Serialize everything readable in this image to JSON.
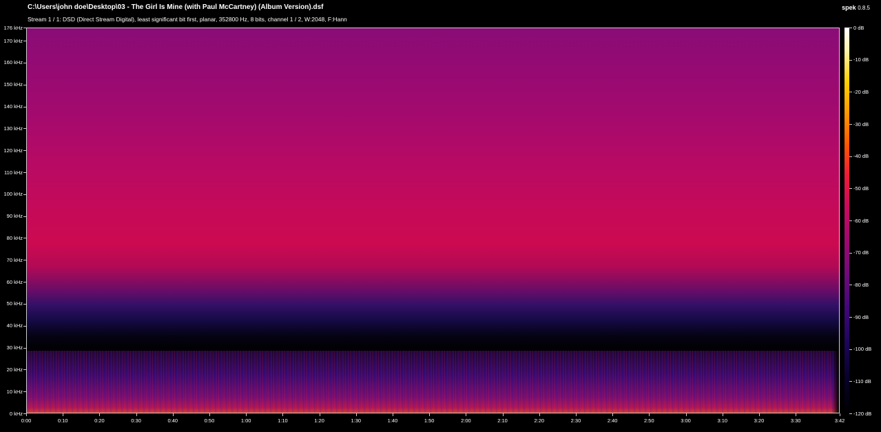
{
  "header": {
    "file_path": "C:\\Users\\john doe\\Desktop\\03 - The Girl Is Mine (with Paul McCartney) (Album Version).dsf",
    "stream_info": "Stream 1 / 1: DSD (Direct Stream Digital), least significant bit first, planar, 352800 Hz, 8 bits, channel 1 / 2, W:2048, F:Hann",
    "app_name": "spek",
    "app_version": "0.8.5"
  },
  "frequency_axis": {
    "labels": [
      "176 kHz",
      "170 kHz",
      "160 kHz",
      "150 kHz",
      "140 kHz",
      "130 kHz",
      "120 kHz",
      "110 kHz",
      "100 kHz",
      "90 kHz",
      "80 kHz",
      "70 kHz",
      "60 kHz",
      "50 kHz",
      "40 kHz",
      "30 kHz",
      "20 kHz",
      "10 kHz",
      "0 kHz"
    ],
    "values_khz": [
      176,
      170,
      160,
      150,
      140,
      130,
      120,
      110,
      100,
      90,
      80,
      70,
      60,
      50,
      40,
      30,
      20,
      10,
      0
    ],
    "max_khz": 176
  },
  "time_axis": {
    "labels": [
      "0:00",
      "0:10",
      "0:20",
      "0:30",
      "0:40",
      "0:50",
      "1:00",
      "1:10",
      "1:20",
      "1:30",
      "1:40",
      "1:50",
      "2:00",
      "2:10",
      "2:20",
      "2:30",
      "2:40",
      "2:50",
      "3:00",
      "3:10",
      "3:20",
      "3:30",
      "3:42"
    ],
    "values_sec": [
      0,
      10,
      20,
      30,
      40,
      50,
      60,
      70,
      80,
      90,
      100,
      110,
      120,
      130,
      140,
      150,
      160,
      170,
      180,
      190,
      200,
      210,
      222
    ],
    "duration_sec": 222
  },
  "db_scale": {
    "labels": [
      "0 dB",
      "-10 dB",
      "-20 dB",
      "-30 dB",
      "-40 dB",
      "-50 dB",
      "-60 dB",
      "-70 dB",
      "-80 dB",
      "-90 dB",
      "-100 dB",
      "-110 dB",
      "-120 dB"
    ],
    "values_db": [
      0,
      -10,
      -20,
      -30,
      -40,
      -50,
      -60,
      -70,
      -80,
      -90,
      -100,
      -110,
      -120
    ],
    "min_db": -120
  },
  "colors": {
    "background": "#000000",
    "frame": "#cfcfcf",
    "text": "#ffffff"
  }
}
